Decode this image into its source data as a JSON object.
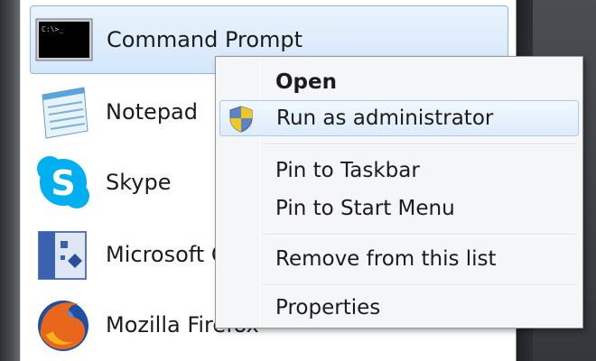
{
  "programs": [
    {
      "label": "Command Prompt",
      "icon": "command-prompt-icon",
      "selected": true
    },
    {
      "label": "Notepad",
      "icon": "notepad-icon"
    },
    {
      "label": "Skype",
      "icon": "skype-icon"
    },
    {
      "label": "Microsoft Office Visio",
      "visible_label": "Microsoft O",
      "icon": "visio-icon"
    },
    {
      "label": "Mozilla Firefox",
      "icon": "firefox-icon"
    }
  ],
  "context_menu": {
    "open": "Open",
    "run_as_admin": "Run as administrator",
    "pin_taskbar": "Pin to Taskbar",
    "pin_start": "Pin to Start Menu",
    "remove": "Remove from this list",
    "properties": "Properties"
  },
  "colors": {
    "selection": "#d4e7fb",
    "selection_border": "#8fb8e6",
    "menu_bg": "#f5f6f7"
  }
}
